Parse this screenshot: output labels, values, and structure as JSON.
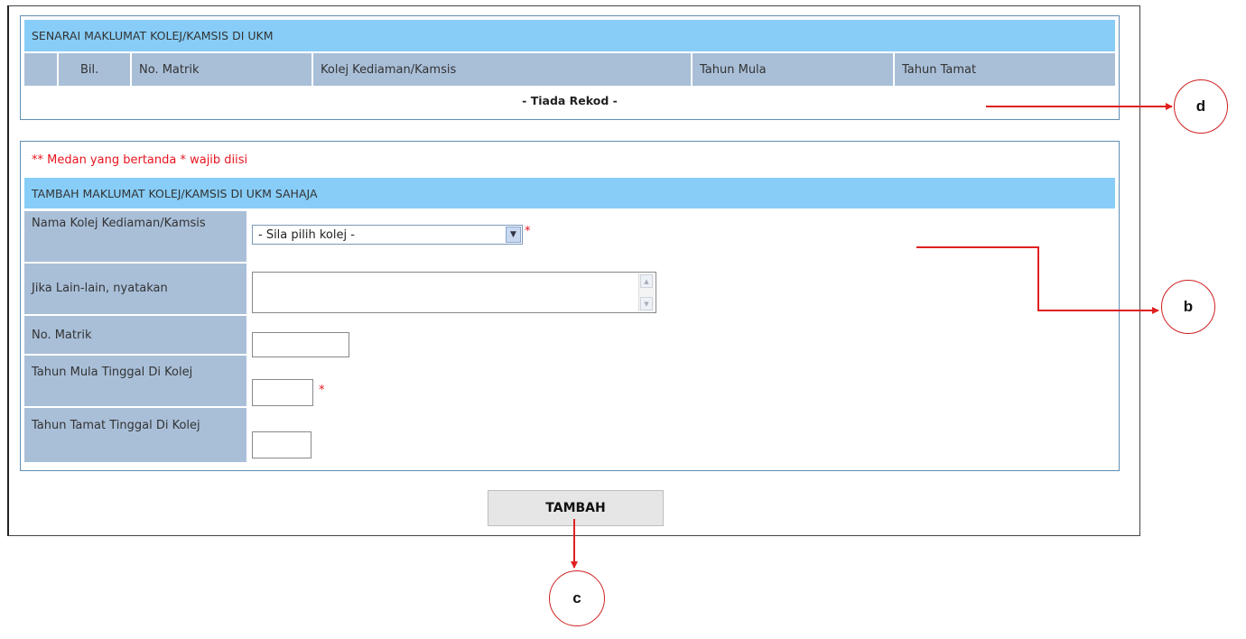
{
  "list_panel": {
    "title": "SENARAI MAKLUMAT KOLEJ/KAMSIS DI UKM",
    "columns": [
      "",
      "Bil.",
      "No. Matrik",
      "Kolej Kediaman/Kamsis",
      "Tahun Mula",
      "Tahun Tamat"
    ],
    "empty_text": "- Tiada Rekod -"
  },
  "form_panel": {
    "required_note": "** Medan yang bertanda * wajib diisi",
    "title": "TAMBAH MAKLUMAT KOLEJ/KAMSIS DI UKM SAHAJA",
    "fields": {
      "college": {
        "label": "Nama Kolej Kediaman/Kamsis",
        "selected": "- Sila pilih kolej -"
      },
      "other": {
        "label": "Jika Lain-lain, nyatakan",
        "value": ""
      },
      "matric": {
        "label": "No. Matrik",
        "value": ""
      },
      "start_year": {
        "label": "Tahun Mula Tinggal Di Kolej",
        "value": ""
      },
      "end_year": {
        "label": "Tahun Tamat Tinggal Di Kolej",
        "value": ""
      }
    },
    "required_mark": "*",
    "submit_label": "TAMBAH"
  },
  "annotations": {
    "d": "d",
    "b": "b",
    "c": "c"
  },
  "colors": {
    "header": "#87cdf8",
    "label_bg": "#a9bfd8",
    "border": "#5f8fb5",
    "required": "#e8141e",
    "arrow": "#e02020"
  },
  "icons": {
    "select_arrow": "chevron-down-icon",
    "scroll_up": "scroll-up-icon",
    "scroll_down": "scroll-down-icon"
  }
}
